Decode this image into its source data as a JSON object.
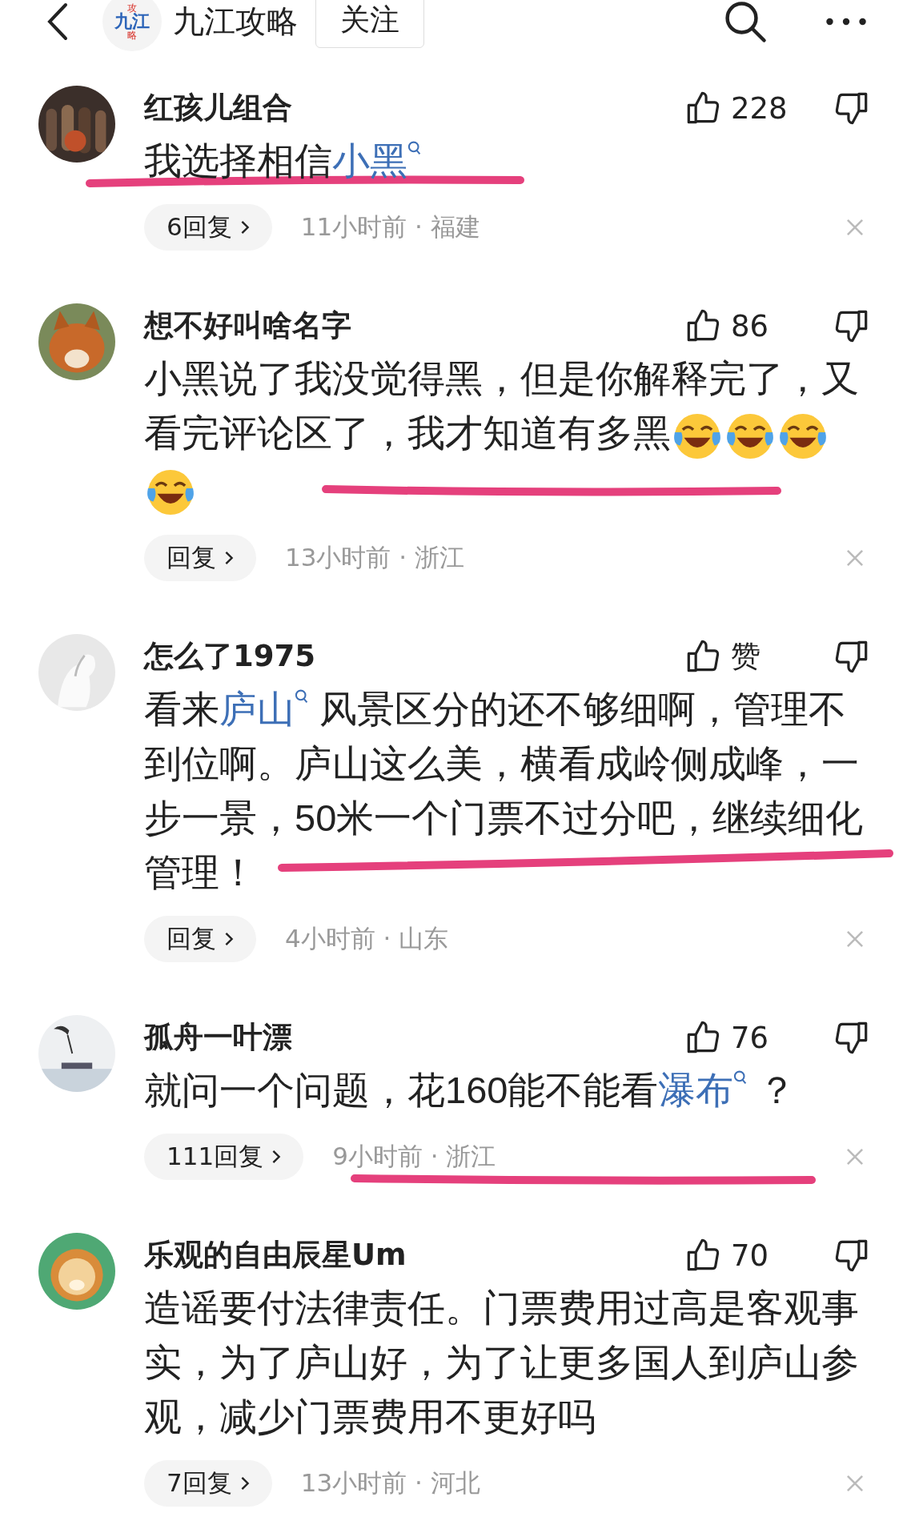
{
  "header": {
    "logo": {
      "lines": [
        "攻",
        "九江",
        "略"
      ]
    },
    "title": "九江攻略",
    "follow_button": "关注"
  },
  "comments": [
    {
      "name": "红孩儿组合",
      "likes": "228",
      "body": [
        {
          "kind": "text",
          "text": "我选择相信"
        },
        {
          "kind": "link",
          "text": "小黑"
        }
      ],
      "replies": "6回复",
      "time_location": "11小时前 · 福建",
      "underlined": true
    },
    {
      "name": "想不好叫啥名字",
      "likes": "86",
      "body": [
        {
          "kind": "text",
          "text": "小黑说了我没觉得黑，但是你解释完了，又看完评论区了，我才知道有多黑"
        },
        {
          "kind": "emoji"
        },
        {
          "kind": "emoji"
        },
        {
          "kind": "emoji"
        },
        {
          "kind": "emoji"
        }
      ],
      "replies": "回复",
      "time_location": "13小时前 · 浙江",
      "underlined": true
    },
    {
      "name": "怎么了1975",
      "likes": "赞",
      "body": [
        {
          "kind": "text",
          "text": "看来"
        },
        {
          "kind": "link",
          "text": "庐山"
        },
        {
          "kind": "text",
          "text": " 风景区分的还不够细啊，管理不到位啊。庐山这么美，横看成岭侧成峰，一步一景，50米一个门票不过分吧，继续细化管理！"
        }
      ],
      "replies": "回复",
      "time_location": "4小时前 · 山东",
      "underlined": true
    },
    {
      "name": "孤舟一叶漂",
      "likes": "76",
      "body": [
        {
          "kind": "text",
          "text": "就问一个问题，花160能不能看"
        },
        {
          "kind": "link",
          "text": "瀑布"
        },
        {
          "kind": "text",
          "text": " ？"
        }
      ],
      "replies": "111回复",
      "time_location": "9小时前 · 浙江",
      "underlined": true
    },
    {
      "name": "乐观的自由辰星Um",
      "likes": "70",
      "body": [
        {
          "kind": "text",
          "text": "造谣要付法律责任。门票费用过高是客观事实，为了庐山好，为了让更多国人到庐山参观，减少门票费用不更好吗"
        }
      ],
      "replies": "7回复",
      "time_location": "13小时前 · 河北",
      "underlined": false
    }
  ]
}
